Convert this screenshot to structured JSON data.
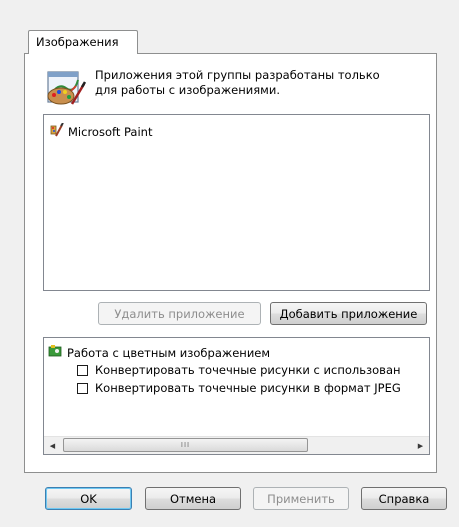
{
  "tab": {
    "label": "Изображения"
  },
  "description": {
    "line1": "Приложения этой группы разработаны только",
    "line2": "для работы с изображениями."
  },
  "app_list": {
    "items": [
      {
        "label": "Microsoft Paint",
        "icon": "paint-icon"
      }
    ]
  },
  "app_buttons": {
    "remove": "Удалить приложение",
    "add": "Добавить приложение"
  },
  "options": {
    "title": "Работа с цветным изображением",
    "items": [
      {
        "label": "Конвертировать точечные рисунки с использован",
        "checked": false
      },
      {
        "label": "Конвертировать точечные рисунки в формат JPEG",
        "checked": false
      }
    ]
  },
  "scrollbar": {
    "grip": "III"
  },
  "dialog_buttons": {
    "ok": "OK",
    "cancel": "Отмена",
    "apply": "Применить",
    "help": "Справка"
  }
}
